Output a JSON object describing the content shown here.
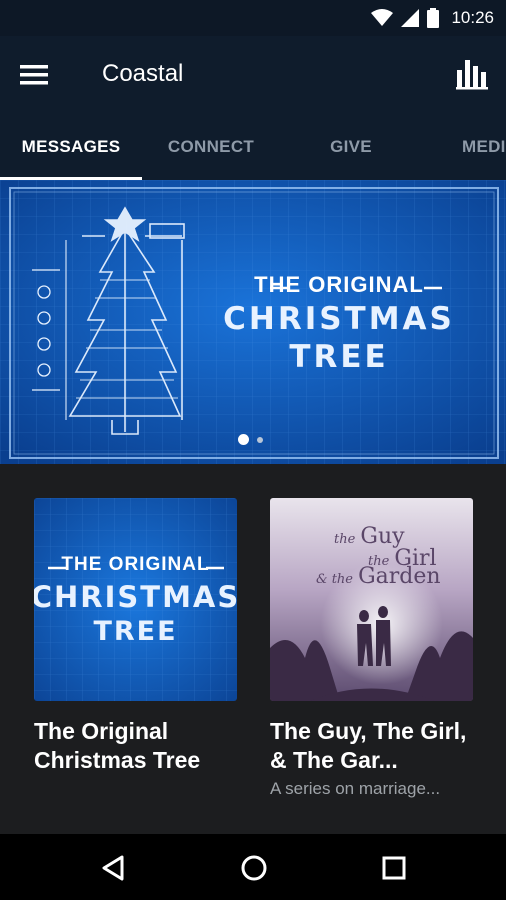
{
  "status_bar": {
    "time": "10:26",
    "icons": [
      "wifi-icon",
      "signal-icon",
      "battery-icon"
    ]
  },
  "app_bar": {
    "title": "Coastal",
    "menu_icon": "menu-icon",
    "action_icon": "bar-chart-icon"
  },
  "tabs": [
    {
      "label": "MESSAGES",
      "active": true
    },
    {
      "label": "CONNECT",
      "active": false
    },
    {
      "label": "GIVE",
      "active": false
    },
    {
      "label": "MEDI",
      "active": false
    }
  ],
  "banner": {
    "line1": "THE ORIGINAL",
    "line2": "CHRISTMAS",
    "line3": "TREE",
    "page_count": 2,
    "current_page": 1
  },
  "cards": [
    {
      "title": "The Original Christmas Tree",
      "subtitle": "",
      "art": {
        "line1": "THE ORIGINAL",
        "line2": "CHRISTMAS",
        "line3": "TREE"
      }
    },
    {
      "title": "The Guy, The Girl, & The Gar...",
      "subtitle": "A series on marriage...",
      "art": {
        "the1": "the",
        "guy": "Guy",
        "the2": "the",
        "girl": "Girl",
        "and_the": "& the",
        "garden": "Garden"
      }
    }
  ],
  "colors": {
    "app_bar": "#0f1c2c",
    "blueprint": "#0d4fa8",
    "background": "#1c1d1f",
    "inactive_tab": "#8e9aa8"
  }
}
